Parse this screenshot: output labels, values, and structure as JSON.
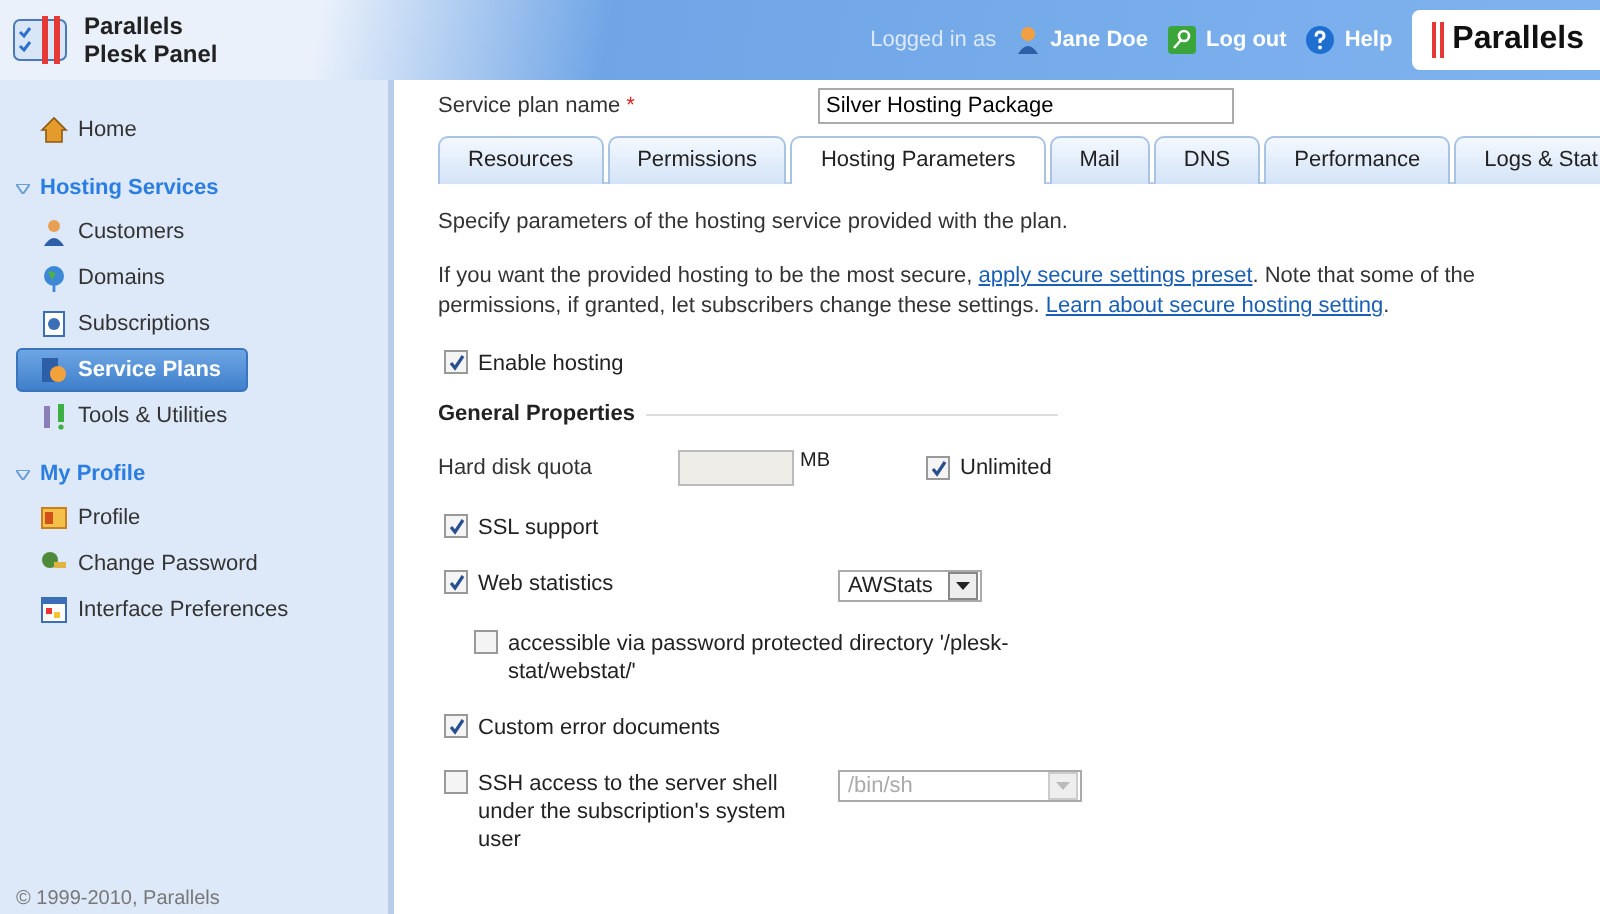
{
  "header": {
    "product": [
      "Parallels",
      "Plesk Panel"
    ],
    "logged_in_label": "Logged in as",
    "user": "Jane Doe",
    "logout": "Log out",
    "help": "Help",
    "brand": "Parallels"
  },
  "sidebar": {
    "items": [
      {
        "kind": "link",
        "label": "Home",
        "selected": false
      },
      {
        "kind": "section",
        "label": "Hosting Services",
        "expanded": true
      },
      {
        "kind": "link",
        "label": "Customers",
        "selected": false
      },
      {
        "kind": "link",
        "label": "Domains",
        "selected": false
      },
      {
        "kind": "link",
        "label": "Subscriptions",
        "selected": false
      },
      {
        "kind": "link",
        "label": "Service Plans",
        "selected": true
      },
      {
        "kind": "link",
        "label": "Tools & Utilities",
        "selected": false
      },
      {
        "kind": "section",
        "label": "My Profile",
        "expanded": true
      },
      {
        "kind": "link",
        "label": "Profile",
        "selected": false
      },
      {
        "kind": "link",
        "label": "Change Password",
        "selected": false
      },
      {
        "kind": "link",
        "label": "Interface Preferences",
        "selected": false
      }
    ],
    "footer": "© 1999-2010, Parallels"
  },
  "plan_name": {
    "label": "Service plan name",
    "required": "*",
    "value": "Silver Hosting Package"
  },
  "tabs": [
    {
      "label": "Resources",
      "selected": false
    },
    {
      "label": "Permissions",
      "selected": false
    },
    {
      "label": "Hosting Parameters",
      "selected": true
    },
    {
      "label": "Mail",
      "selected": false
    },
    {
      "label": "DNS",
      "selected": false
    },
    {
      "label": "Performance",
      "selected": false
    },
    {
      "label": "Logs & Stat",
      "selected": false
    }
  ],
  "intro": "Specify parameters of the hosting service provided with the plan.",
  "secure_note": [
    "If you want the provided hosting to be the most secure, ",
    "apply secure settings preset",
    ". Note that some of the permissions, if granted, let subscribers change these settings. ",
    "Learn about secure hosting setting",
    "."
  ],
  "enable_hosting": {
    "label": "Enable hosting",
    "checked": true
  },
  "section_title": "General Properties",
  "fields": [
    {
      "kind": "quota",
      "label": "Hard disk quota",
      "unit": "MB",
      "option": "Unlimited",
      "checked": true
    },
    {
      "kind": "checkbox",
      "label": "SSL support",
      "checked": true
    },
    {
      "kind": "select",
      "label": "Web statistics",
      "checked": true,
      "value": "AWStats",
      "disabled": false
    },
    {
      "kind": "subcheckbox",
      "label": "accessible via password protected directory '/plesk-stat/webstat/'",
      "checked": false
    },
    {
      "kind": "checkbox",
      "label": "Custom error documents",
      "checked": true
    },
    {
      "kind": "select",
      "label": "SSH access to the server shell under the subscription's system user",
      "checked": false,
      "value": "/bin/sh",
      "disabled": true
    }
  ]
}
